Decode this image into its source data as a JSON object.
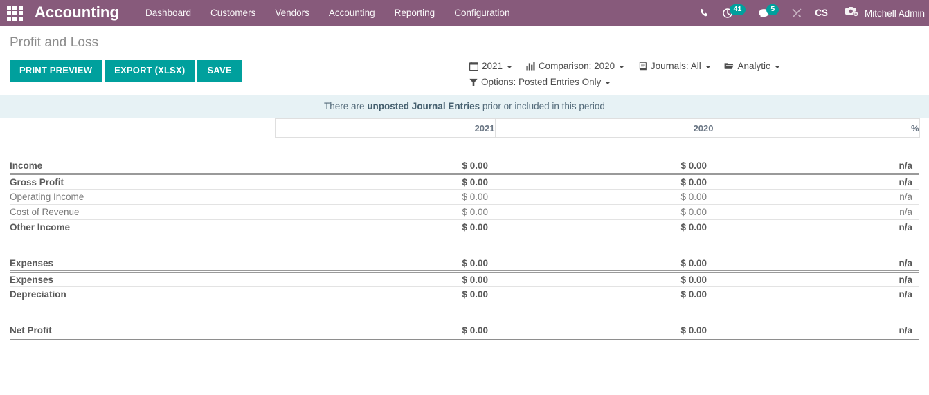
{
  "navbar": {
    "apps_icon": "apps-grid-icon",
    "brand": "Accounting",
    "menu": [
      {
        "label": "Dashboard"
      },
      {
        "label": "Customers"
      },
      {
        "label": "Vendors"
      },
      {
        "label": "Accounting"
      },
      {
        "label": "Reporting"
      },
      {
        "label": "Configuration"
      }
    ],
    "phone_icon": "phone-icon",
    "activity_icon": "clock-icon",
    "activity_count": "41",
    "messages_icon": "chat-bubble-icon",
    "messages_count": "5",
    "tools_icon": "tools-icon",
    "company_code": "CS",
    "avatar_icon": "camera-avatar-icon",
    "user_name": "Mitchell Admin",
    "bg_color": "#875A7B",
    "badge_color": "#00A09D"
  },
  "control_panel": {
    "title": "Profit and Loss",
    "buttons": [
      {
        "label": "PRINT PREVIEW",
        "name": "print-preview-button"
      },
      {
        "label": "EXPORT (XLSX)",
        "name": "export-xlsx-button"
      },
      {
        "label": "SAVE",
        "name": "save-button"
      }
    ],
    "button_color": "#00A09D",
    "filters_row1": [
      {
        "label": "2021",
        "icon": "calendar-icon",
        "name": "date-filter"
      },
      {
        "label": "Comparison: 2020",
        "icon": "bar-chart-icon",
        "name": "comparison-filter"
      },
      {
        "label": "Journals: All",
        "icon": "book-icon",
        "name": "journals-filter"
      },
      {
        "label": "Analytic",
        "icon": "folder-icon",
        "name": "analytic-filter"
      }
    ],
    "filters_row2": [
      {
        "label": "Options: Posted Entries Only",
        "icon": "filter-icon",
        "name": "options-filter"
      }
    ]
  },
  "banner": {
    "prefix": "There are ",
    "strong": "unposted Journal Entries",
    "suffix": " prior or included in this period",
    "bg_color": "#E7F2F5"
  },
  "chart_data": {
    "type": "table",
    "title": "Profit and Loss",
    "columns": [
      "",
      "2021",
      "2020",
      "%"
    ],
    "rows": [
      {
        "name": "Income",
        "level": 0,
        "v2021": "$ 0.00",
        "v2020": "$ 0.00",
        "pct": "n/a"
      },
      {
        "name": "Gross Profit",
        "level": 1,
        "v2021": "$ 0.00",
        "v2020": "$ 0.00",
        "pct": "n/a"
      },
      {
        "name": "Operating Income",
        "level": 2,
        "v2021": "$ 0.00",
        "v2020": "$ 0.00",
        "pct": "n/a"
      },
      {
        "name": "Cost of Revenue",
        "level": 2,
        "v2021": "$ 0.00",
        "v2020": "$ 0.00",
        "pct": "n/a"
      },
      {
        "name": "Other Income",
        "level": 1,
        "v2021": "$ 0.00",
        "v2020": "$ 0.00",
        "pct": "n/a"
      },
      {
        "name": "",
        "level": -1,
        "v2021": "",
        "v2020": "",
        "pct": ""
      },
      {
        "name": "Expenses",
        "level": 0,
        "v2021": "$ 0.00",
        "v2020": "$ 0.00",
        "pct": "n/a"
      },
      {
        "name": "Expenses",
        "level": 1,
        "v2021": "$ 0.00",
        "v2020": "$ 0.00",
        "pct": "n/a"
      },
      {
        "name": "Depreciation",
        "level": 1,
        "v2021": "$ 0.00",
        "v2020": "$ 0.00",
        "pct": "n/a"
      },
      {
        "name": "",
        "level": -1,
        "v2021": "",
        "v2020": "",
        "pct": ""
      },
      {
        "name": "Net Profit",
        "level": 0,
        "v2021": "$ 0.00",
        "v2020": "$ 0.00",
        "pct": "n/a",
        "total": true
      }
    ]
  }
}
